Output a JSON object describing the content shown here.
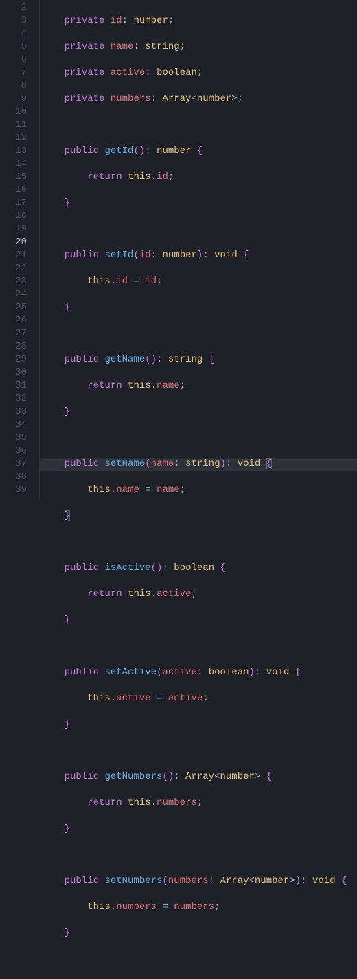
{
  "editor": {
    "first_line": 2,
    "current_line": 20,
    "kw": {
      "private": "private",
      "public": "public",
      "return": "return",
      "this": "this"
    },
    "types": {
      "number": "number",
      "string": "string",
      "boolean": "boolean",
      "void": "void",
      "Array": "Array"
    },
    "fields": {
      "id": "id",
      "name": "name",
      "active": "active",
      "numbers": "numbers"
    },
    "methods": {
      "getId": "getId",
      "setId": "setId",
      "getName": "getName",
      "setName": "setName",
      "isActive": "isActive",
      "setActive": "setActive",
      "getNumbers": "getNumbers",
      "setNumbers": "setNumbers"
    },
    "lines_numbers": [
      "2",
      "3",
      "4",
      "5",
      "6",
      "7",
      "8",
      "9",
      "10",
      "11",
      "12",
      "13",
      "14",
      "15",
      "16",
      "17",
      "18",
      "19",
      "20",
      "21",
      "22",
      "23",
      "24",
      "25",
      "26",
      "27",
      "28",
      "29",
      "30",
      "31",
      "32",
      "33",
      "34",
      "35",
      "36",
      "37",
      "38",
      "39"
    ]
  }
}
